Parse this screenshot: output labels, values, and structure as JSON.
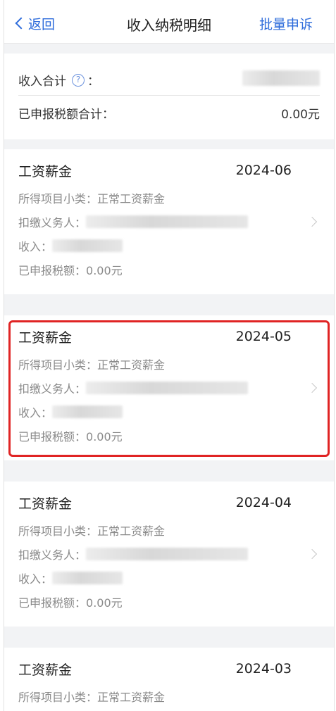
{
  "nav": {
    "back_label": "返回",
    "title": "收入纳税明细",
    "right_action": "批量申诉"
  },
  "summary": {
    "income_total_label": "收入合计",
    "income_total_colon": "：",
    "declared_tax_total_label": "已申报税额合计：",
    "declared_tax_total_value": "0.00元"
  },
  "records": [
    {
      "title": "工资薪金",
      "period": "2024-06",
      "subcategory_label": "所得项目小类：",
      "subcategory_value": "正常工资薪金",
      "withholder_label": "扣缴义务人：",
      "income_label": "收入：",
      "tax_label": "已申报税额：",
      "tax_value": "0.00元"
    },
    {
      "title": "工资薪金",
      "period": "2024-05",
      "subcategory_label": "所得项目小类：",
      "subcategory_value": "正常工资薪金",
      "withholder_label": "扣缴义务人：",
      "income_label": "收入：",
      "tax_label": "已申报税额：",
      "tax_value": "0.00元"
    },
    {
      "title": "工资薪金",
      "period": "2024-04",
      "subcategory_label": "所得项目小类：",
      "subcategory_value": "正常工资薪金",
      "withholder_label": "扣缴义务人：",
      "income_label": "收入：",
      "tax_label": "已申报税额：",
      "tax_value": "0.00元"
    },
    {
      "title": "工资薪金",
      "period": "2024-03",
      "subcategory_label": "所得项目小类：",
      "subcategory_value": "正常工资薪金"
    }
  ],
  "highlight_color": "#e02424",
  "accent_color": "#2e6cdb"
}
